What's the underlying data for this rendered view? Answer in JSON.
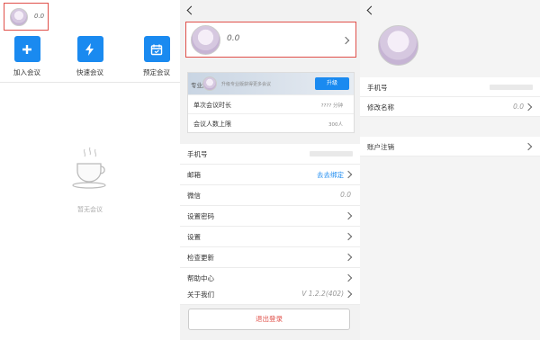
{
  "home": {
    "profile": {
      "name": "0.0"
    },
    "actions": [
      {
        "label": "加入会议",
        "icon": "plus-icon"
      },
      {
        "label": "快速会议",
        "icon": "lightning-icon"
      },
      {
        "label": "预定会议",
        "icon": "calendar-icon"
      }
    ],
    "empty": {
      "icon": "coffee-cup-icon",
      "text": "暂无会议"
    }
  },
  "me": {
    "profile": {
      "name": "0.0"
    },
    "meeting_box": {
      "upgrade_title": "专业版",
      "upgrade_hint": "升级专业版获得更多会议",
      "upgrade_button": "升级",
      "rows": [
        {
          "label": "单次会议时长",
          "value": "???? 分钟"
        },
        {
          "label": "会议人数上限",
          "value": "300人"
        }
      ]
    },
    "settings": [
      {
        "label": "手机号",
        "value": ""
      },
      {
        "label": "邮箱",
        "value": "去去绑定"
      },
      {
        "label": "微信",
        "value": "0.0"
      },
      {
        "label": "设置密码",
        "value": ""
      },
      {
        "label": "设置",
        "value": ""
      },
      {
        "label": "检查更新",
        "value": ""
      },
      {
        "label": "帮助中心",
        "value": ""
      },
      {
        "label": "关于我们",
        "value": "V 1.2.2(402)"
      }
    ],
    "logout_label": "退出登录"
  },
  "profile_detail": {
    "rows": [
      {
        "label": "手机号",
        "value": ""
      },
      {
        "label": "修改名称",
        "value": "0.0"
      },
      {
        "label": "账户注销",
        "value": ""
      }
    ]
  },
  "colors": {
    "accent": "#1a8af0",
    "highlight": "#e0504a"
  }
}
